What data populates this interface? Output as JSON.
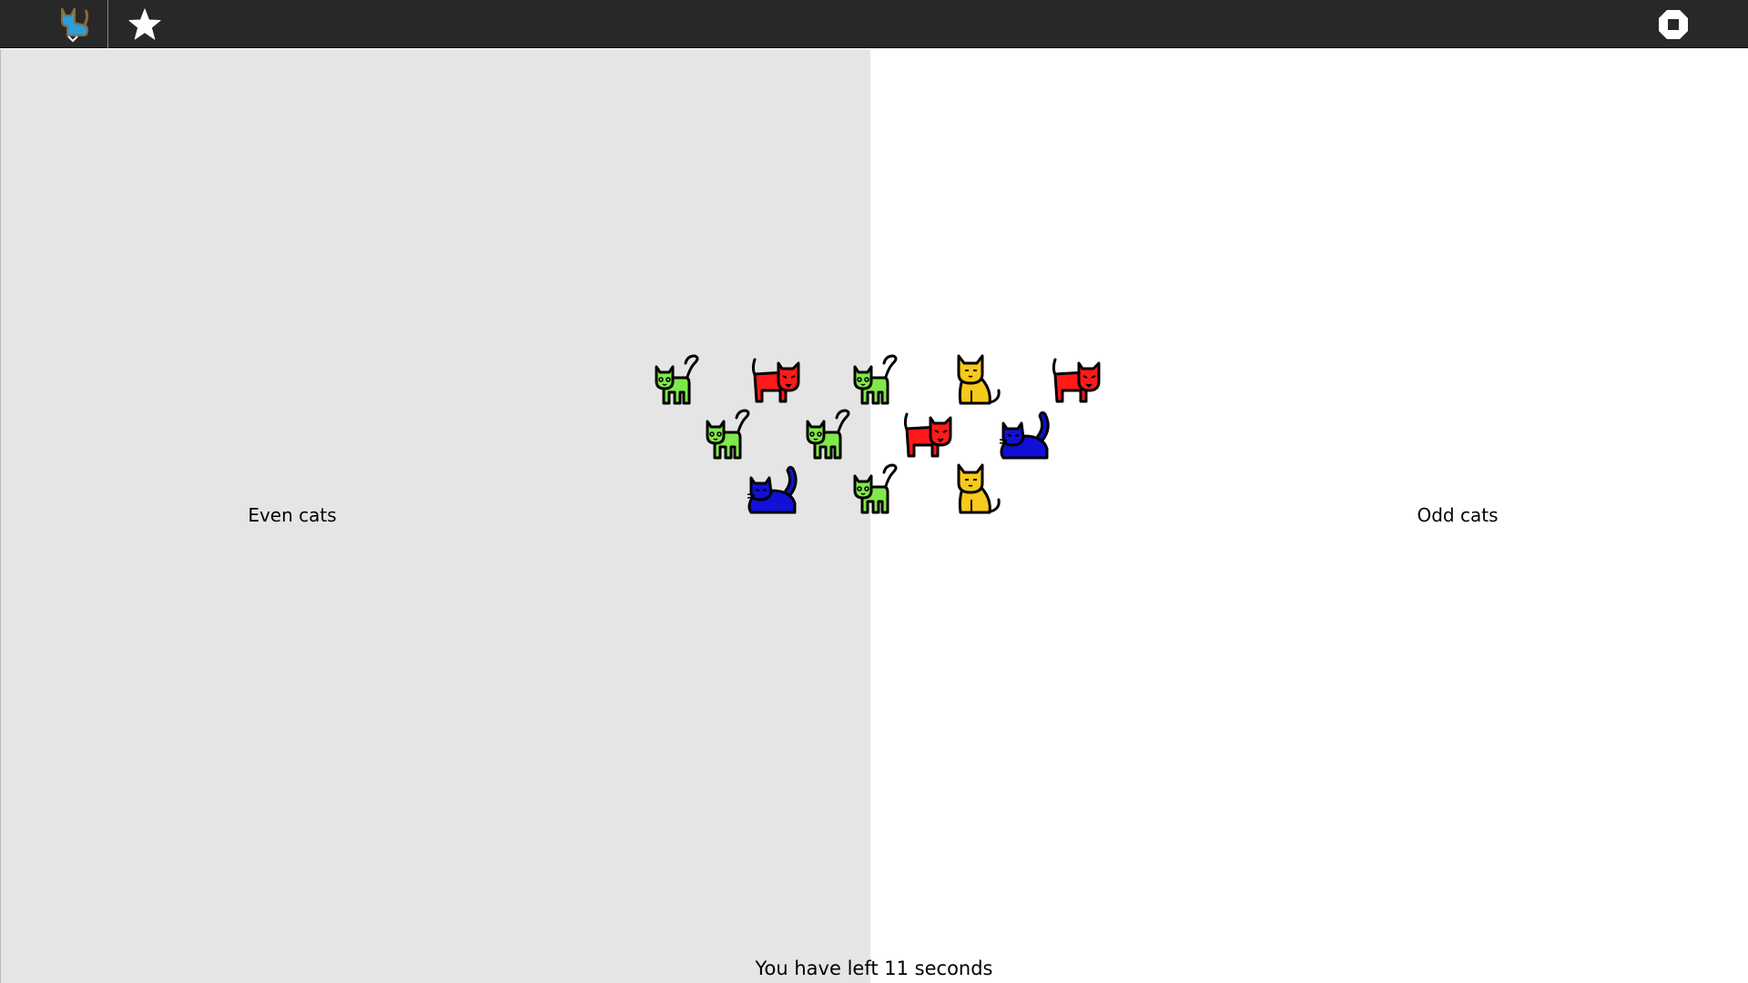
{
  "toolbar": {
    "activity_icon": "cat-icon",
    "star_icon": "star-icon",
    "stop_icon": "stop-icon",
    "background": "#282828"
  },
  "zones": {
    "even": {
      "label": "Even cats",
      "color": "#e5e5e5"
    },
    "odd": {
      "label": "Odd cats",
      "color": "#ffffff"
    }
  },
  "timer": "You have left 11 seconds",
  "cat_colors": {
    "green": "#80e84a",
    "red": "#ff1a1a",
    "yellow": "#f7c91a",
    "blue": "#1010d8"
  },
  "cats": [
    {
      "color": "green",
      "pose": "tail-up"
    },
    {
      "color": "red",
      "pose": "walking"
    },
    {
      "color": "green",
      "pose": "tail-up"
    },
    {
      "color": "yellow",
      "pose": "sitting"
    },
    {
      "color": "red",
      "pose": "walking"
    },
    {
      "color": "green",
      "pose": "tail-up"
    },
    {
      "color": "green",
      "pose": "tail-up"
    },
    {
      "color": "red",
      "pose": "walking"
    },
    {
      "color": "blue",
      "pose": "crouching"
    },
    {
      "color": "blue",
      "pose": "crouching"
    },
    {
      "color": "green",
      "pose": "tail-up"
    },
    {
      "color": "yellow",
      "pose": "sitting"
    }
  ]
}
